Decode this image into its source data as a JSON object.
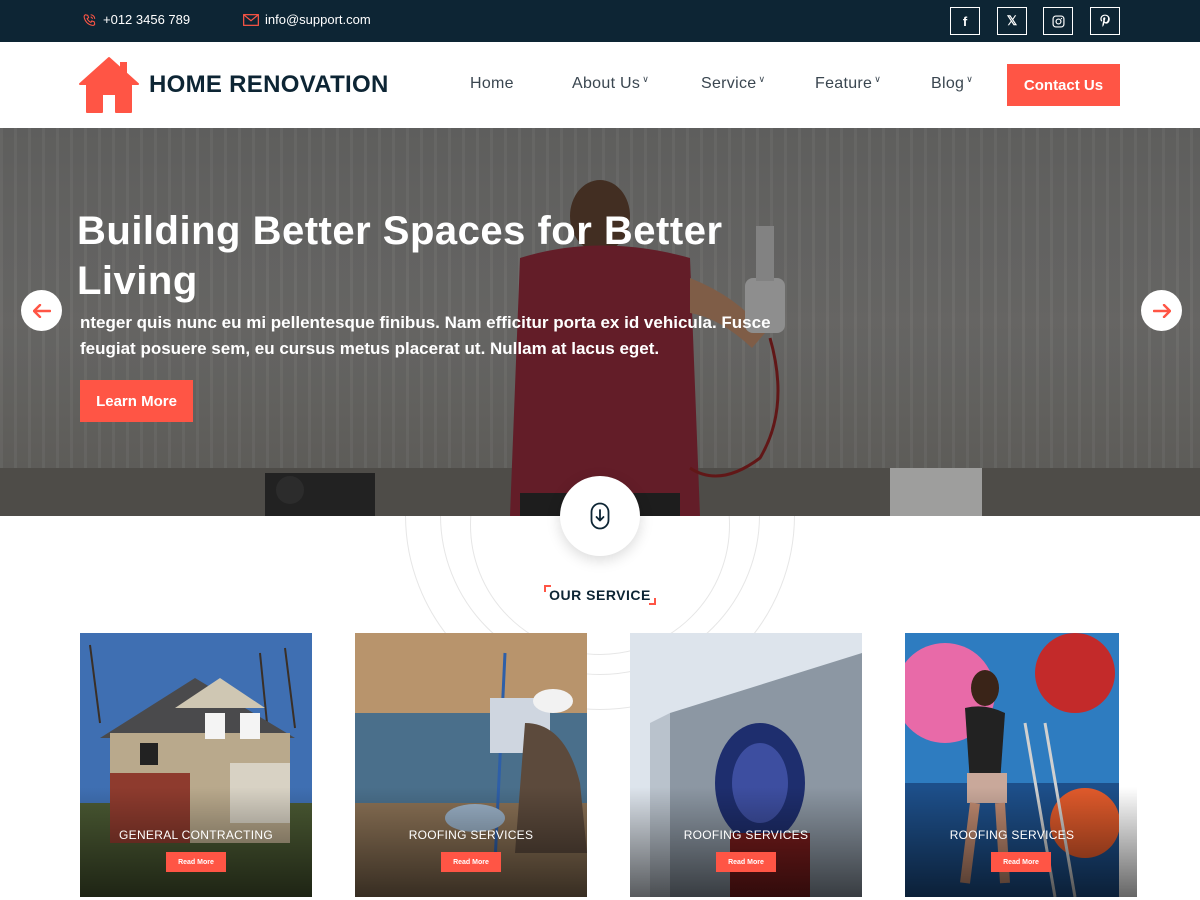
{
  "topbar": {
    "phone": "+012 3456 789",
    "email": "info@support.com",
    "social": [
      {
        "icon": "facebook-icon",
        "glyph": "f"
      },
      {
        "icon": "x-icon",
        "glyph": "𝕏"
      },
      {
        "icon": "instagram-icon",
        "glyph": "◎"
      },
      {
        "icon": "pinterest-icon",
        "glyph": "℗"
      }
    ]
  },
  "header": {
    "brand": "HOME RENOVATION",
    "nav": [
      {
        "label": "Home",
        "has_dropdown": false
      },
      {
        "label": "About Us",
        "has_dropdown": true
      },
      {
        "label": "Service",
        "has_dropdown": true
      },
      {
        "label": "Feature",
        "has_dropdown": true
      },
      {
        "label": "Blog",
        "has_dropdown": true
      }
    ],
    "contact_button": "Contact Us"
  },
  "hero": {
    "title": "Building Better Spaces for Better Living",
    "text": "nteger quis nunc eu mi pellentesque finibus. Nam efficitur porta ex id vehicula. Fusce feugiat posuere sem, eu cursus metus placerat ut. Nullam at lacus eget.",
    "button": "Learn More"
  },
  "services": {
    "label": "OUR SERVICE",
    "cards": [
      {
        "title": "GENERAL CONTRACTING",
        "button": "Read More"
      },
      {
        "title": "ROOFING SERVICES",
        "button": "Read More"
      },
      {
        "title": "ROOFING SERVICES",
        "button": "Read More"
      },
      {
        "title": "ROOFING SERVICES",
        "button": "Read More"
      }
    ]
  },
  "colors": {
    "accent": "#ff5545",
    "dark": "#0d2534"
  }
}
